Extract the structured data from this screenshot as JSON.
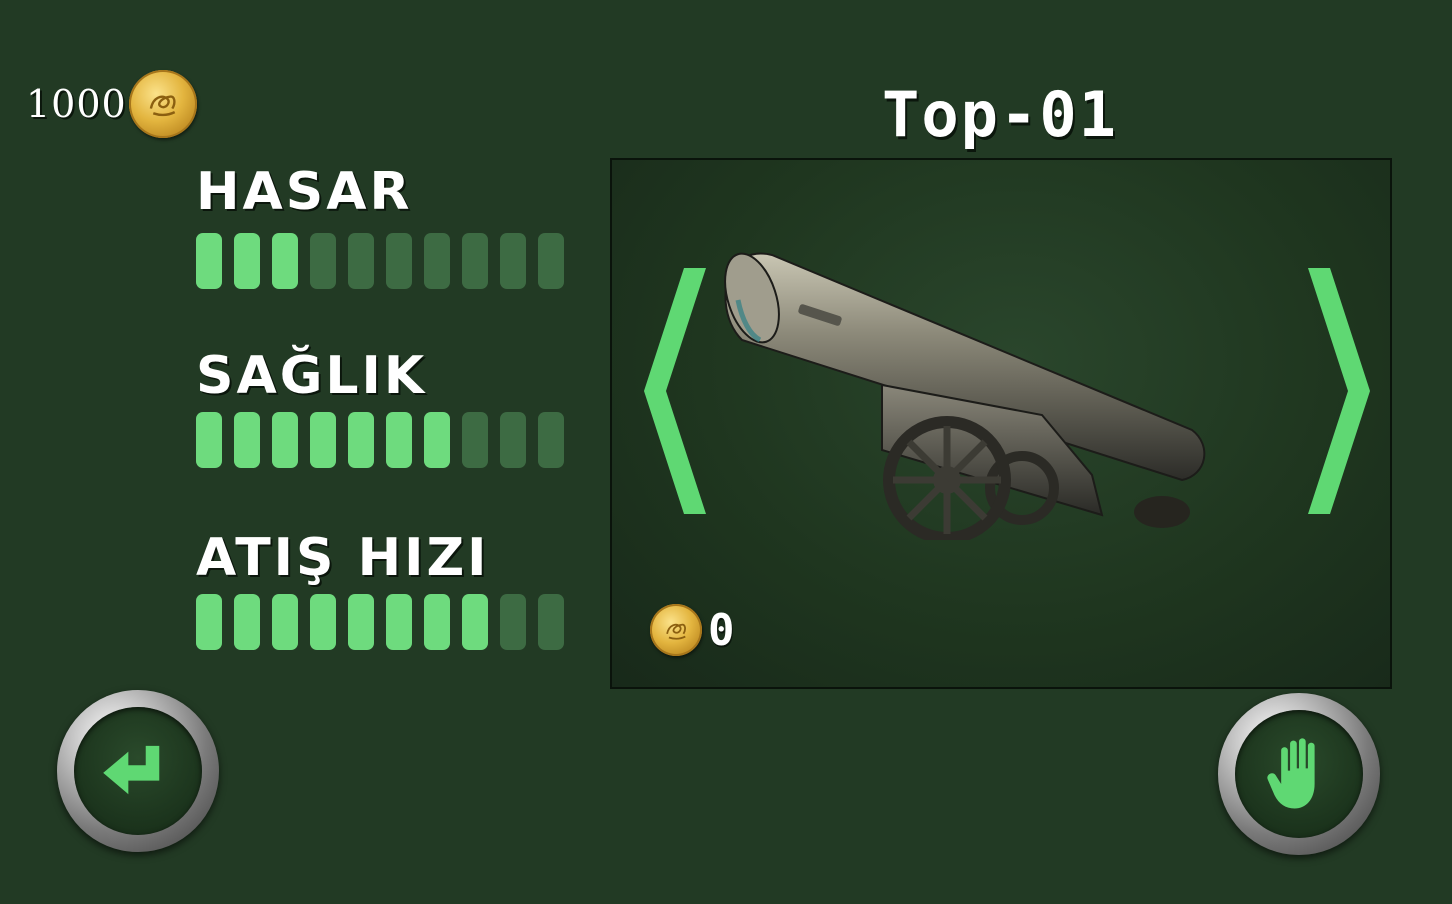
{
  "currency": {
    "balance": "1000",
    "icon": "gold-coin-icon"
  },
  "stats": [
    {
      "label": "HASAR",
      "level": 3,
      "max": 10
    },
    {
      "label": "SAĞLIK",
      "level": 7,
      "max": 10
    },
    {
      "label": "ATIŞ HIZI",
      "level": 8,
      "max": 10
    }
  ],
  "item": {
    "name": "Top-01",
    "price": "0",
    "image": "cannon-image"
  },
  "controls": {
    "prev_icon": "chevron-double-left-icon",
    "next_icon": "chevron-double-right-icon",
    "back_icon": "return-arrow-icon",
    "select_icon": "hand-icon"
  },
  "colors": {
    "background": "#223a24",
    "bar_active": "#6edb7e",
    "bar_inactive": "#3d6b43",
    "arrow": "#5fd873"
  }
}
